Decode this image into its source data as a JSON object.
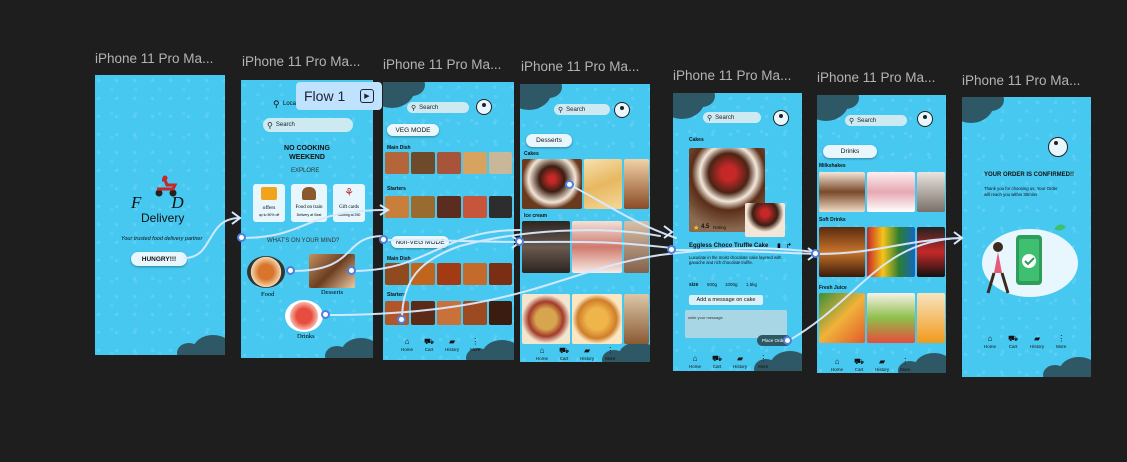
{
  "frame_titles": [
    "iPhone 11 Pro Ma...",
    "iPhone 11 Pro Ma...",
    "iPhone 11 Pro Ma...",
    "iPhone 11 Pro Ma...",
    "iPhone 11 Pro Ma...",
    "iPhone 11 Pro Ma...",
    "iPhone 11 Pro Ma..."
  ],
  "flow": {
    "label": "Flow 1"
  },
  "splash": {
    "brand_prefix": "F",
    "brand_mid": "D",
    "brand_name": "Delivery",
    "tagline": "Your trusted food delivery partner",
    "cta": "HUNGRY!!!"
  },
  "home": {
    "location": "Loca",
    "search": "Search",
    "headline": "NO COOKING WEEKEND",
    "explore": "EXPLORE",
    "cards": [
      {
        "title": "offers",
        "sub": "up to 50% off"
      },
      {
        "title": "Food on train",
        "sub": "Delivery at Seat"
      },
      {
        "title": "Gift cards",
        "sub": "Starting at 250"
      }
    ],
    "mind": "WHAT'S ON YOUR MIND?",
    "categories": [
      "Food",
      "Desserts",
      "Drinks"
    ]
  },
  "menu": {
    "search": "Search",
    "veg": "VEG MODE",
    "nonveg": "Non-VEG MODE",
    "sections": [
      "Main Dish",
      "Starters",
      "Main Dish",
      "Starters"
    ]
  },
  "desserts": {
    "search": "Search",
    "tag": "Desserts",
    "sections": [
      "Cakes",
      "Ice cream"
    ]
  },
  "product": {
    "search": "Search",
    "section": "Cakes",
    "rating": "4.5",
    "rating_label": "Rating",
    "name": "Eggless Choco Truffle Cake",
    "desc": "Luxuriate in the moist chocolate cake layered with ganache and rich chocolate truffle.",
    "size_label": "size",
    "sizes": [
      "500g",
      "1000g",
      "1.5kg"
    ],
    "message_btn": "Add a message on cake",
    "message_placeholder": "write your message",
    "place_order": "Place Order"
  },
  "drinks": {
    "search": "Search",
    "tag": "Drinks",
    "sections": [
      "Milkshakes",
      "Soft Drinks",
      "Fresh Juice"
    ]
  },
  "confirm": {
    "title": "YOUR ORDER IS CONFIRMED!!",
    "message": "Thank you for choosing us. Your Order will reach you within 30mins"
  },
  "nav": {
    "home": "Home",
    "cart": "Cart",
    "history": "History",
    "more": "More"
  },
  "colors": {
    "canvas": "#1e1e1e",
    "frame_bg": "#47c8f0",
    "blob": "#2f5866",
    "wire": "#d9eaff",
    "flow_bg": "#bfe3ff"
  }
}
